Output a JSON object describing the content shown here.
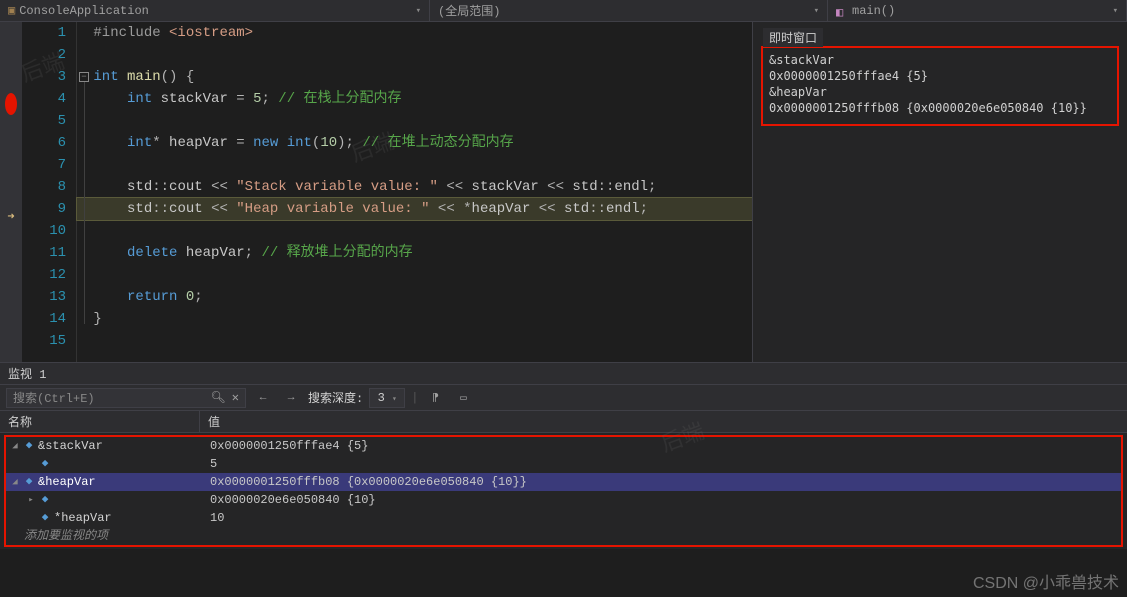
{
  "topbar": {
    "project": "ConsoleApplication",
    "scope": "(全局范围)",
    "function": "main()"
  },
  "immediate": {
    "title": "即时窗口",
    "lines": [
      "&stackVar",
      "0x0000001250fffae4 {5}",
      "&heapVar",
      "0x0000001250fffb08 {0x0000020e6e050840 {10}}"
    ]
  },
  "editor": {
    "current_line": 9,
    "breakpoint_line": 4,
    "lines": [
      {
        "n": 1,
        "html": "<span class='preproc'>#include </span><span class='string'>&lt;iostream&gt;</span>"
      },
      {
        "n": 2,
        "html": ""
      },
      {
        "n": 3,
        "html": "<span class='keyword'>int</span> <span class='func'>main</span><span class='op'>() {</span>",
        "fold": true
      },
      {
        "n": 4,
        "html": "    <span class='keyword'>int</span> <span class='ident'>stackVar</span> <span class='op'>=</span> <span class='number'>5</span><span class='op'>;</span> <span class='comment'>// 在栈上分配内存</span>"
      },
      {
        "n": 5,
        "html": ""
      },
      {
        "n": 6,
        "html": "    <span class='keyword'>int</span><span class='op'>*</span> <span class='ident'>heapVar</span> <span class='op'>=</span> <span class='keyword'>new</span> <span class='keyword'>int</span><span class='op'>(</span><span class='number'>10</span><span class='op'>);</span> <span class='comment'>// 在堆上动态分配内存</span>"
      },
      {
        "n": 7,
        "html": ""
      },
      {
        "n": 8,
        "html": "    <span class='ns'>std</span><span class='op'>::</span><span class='ident'>cout</span> <span class='op'>&lt;&lt;</span> <span class='string'>\"Stack variable value: \"</span> <span class='op'>&lt;&lt;</span> <span class='ident'>stackVar</span> <span class='op'>&lt;&lt;</span> <span class='ns'>std</span><span class='op'>::</span><span class='ident'>endl</span><span class='op'>;</span>"
      },
      {
        "n": 9,
        "html": "    <span class='ns'>std</span><span class='op'>::</span><span class='ident'>cout</span> <span class='op'>&lt;&lt;</span> <span class='string'>\"Heap variable value: \"</span> <span class='op'>&lt;&lt;</span> <span class='op'>*</span><span class='ident'>heapVar</span> <span class='op'>&lt;&lt;</span> <span class='ns'>std</span><span class='op'>::</span><span class='ident'>endl</span><span class='op'>;</span>"
      },
      {
        "n": 10,
        "html": ""
      },
      {
        "n": 11,
        "html": "    <span class='keyword'>delete</span> <span class='ident'>heapVar</span><span class='op'>;</span> <span class='comment'>// 释放堆上分配的内存</span>"
      },
      {
        "n": 12,
        "html": ""
      },
      {
        "n": 13,
        "html": "    <span class='keyword'>return</span> <span class='number'>0</span><span class='op'>;</span>"
      },
      {
        "n": 14,
        "html": "<span class='op'>}</span>"
      },
      {
        "n": 15,
        "html": ""
      }
    ]
  },
  "watch": {
    "title": "监视 1",
    "search_placeholder": "搜索(Ctrl+E)",
    "depth_label": "搜索深度:",
    "depth_value": "3",
    "col_name": "名称",
    "col_value": "值",
    "add_item": "添加要监视的项",
    "rows": [
      {
        "indent": 0,
        "exp": "▢",
        "open": true,
        "name": "&stackVar",
        "value": "0x0000001250fffae4 {5}",
        "sel": false
      },
      {
        "indent": 1,
        "exp": "",
        "name": "",
        "value": "5",
        "sel": false
      },
      {
        "indent": 0,
        "exp": "▢",
        "open": true,
        "name": "&heapVar",
        "value": "0x0000001250fffb08 {0x0000020e6e050840 {10}}",
        "sel": true
      },
      {
        "indent": 1,
        "exp": "▸",
        "name": "",
        "value": "0x0000020e6e050840 {10}",
        "sel": false
      },
      {
        "indent": 1,
        "exp": "",
        "name": "*heapVar",
        "value": "10",
        "sel": false
      }
    ]
  },
  "watermark": "CSDN @小乖兽技术",
  "wm_diag": "后端"
}
